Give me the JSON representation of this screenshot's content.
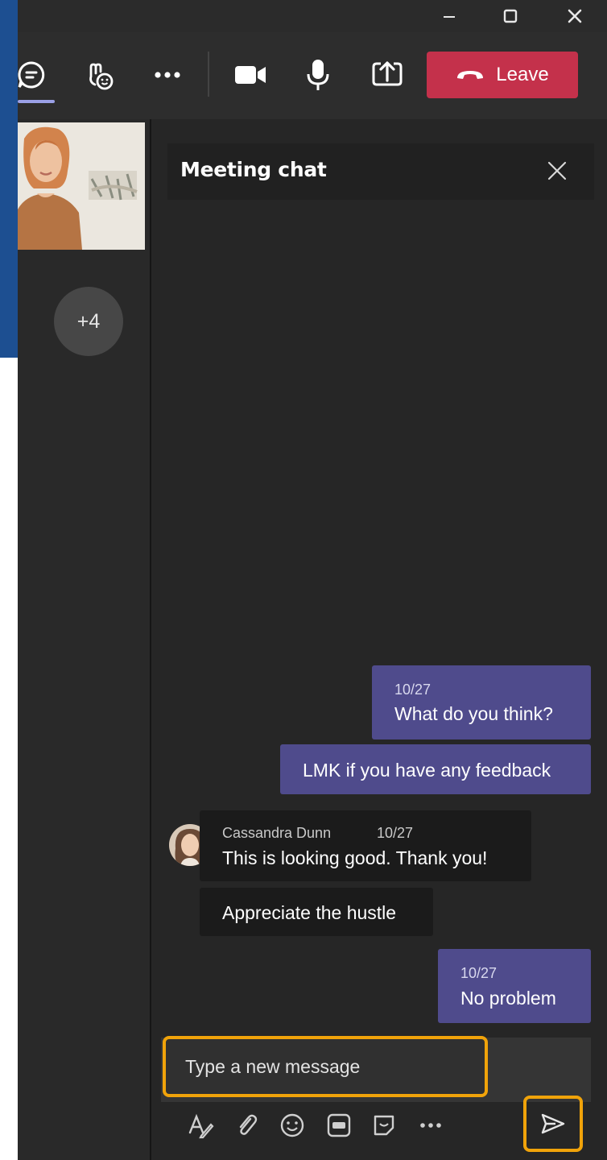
{
  "window": {
    "controls": [
      "minimize-icon",
      "maximize-icon",
      "close-icon"
    ]
  },
  "toolbar": {
    "buttons": [
      "chat-icon",
      "reactions-icon",
      "more-options-icon",
      "camera-icon",
      "microphone-icon",
      "share-screen-icon"
    ],
    "leave_label": "Leave",
    "leave_color": "#c4314b",
    "accent_color": "#9aa0e6"
  },
  "stage": {
    "overflow_count": "+4"
  },
  "chat": {
    "title": "Meeting chat",
    "messages": [
      {
        "direction": "outgoing",
        "timestamp": "10/27",
        "text": "What do you think?"
      },
      {
        "direction": "outgoing",
        "text": "LMK if you have any feedback"
      },
      {
        "direction": "incoming",
        "sender": "Cassandra Dunn",
        "timestamp": "10/27",
        "text": "This is looking good. Thank you!"
      },
      {
        "direction": "incoming",
        "text": "Appreciate the hustle"
      },
      {
        "direction": "outgoing",
        "timestamp": "10/27",
        "text": "No problem"
      }
    ],
    "outgoing_bubble_color": "#4f4b8c",
    "compose": {
      "placeholder": "Type a new message",
      "highlight_color": "#f0a30a",
      "tools": [
        "format-icon",
        "attach-icon",
        "emoji-icon",
        "gif-icon",
        "sticker-icon",
        "more-icon"
      ],
      "send": "send-icon"
    }
  }
}
